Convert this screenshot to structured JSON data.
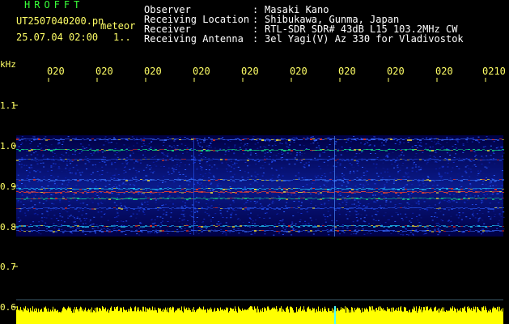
{
  "header": {
    "brand": "HROFFT",
    "filename": "UT2507040200.pn",
    "suffix": "meteor",
    "datetime": "25.07.04 02:00",
    "index": "1..",
    "meta": [
      {
        "label": "Observer",
        "value": "Masaki Kano"
      },
      {
        "label": "Receiving Location",
        "value": "Shibukawa, Gunma, Japan"
      },
      {
        "label": "Receiver",
        "value": "RTL-SDR SDR# 43dB L15 103.2MHz CW"
      },
      {
        "label": "Receiving Antenna",
        "value": "3el Yagi(V) Az 330 for Vladivostok"
      }
    ]
  },
  "axes": {
    "unit": "kHz",
    "time_ticks": [
      "020",
      "020",
      "020",
      "020",
      "020",
      "020",
      "020",
      "020",
      "020",
      "0210"
    ],
    "freq_ticks": [
      "1.1",
      "1.0",
      "0.9",
      "0.8",
      "0.7",
      "0.6"
    ]
  },
  "colors": {
    "background": "#000000",
    "header_text": "#ffffff",
    "label_yellow": "#ffff66",
    "brand_green": "#39ff39",
    "level_bar": "#ffff00"
  }
}
